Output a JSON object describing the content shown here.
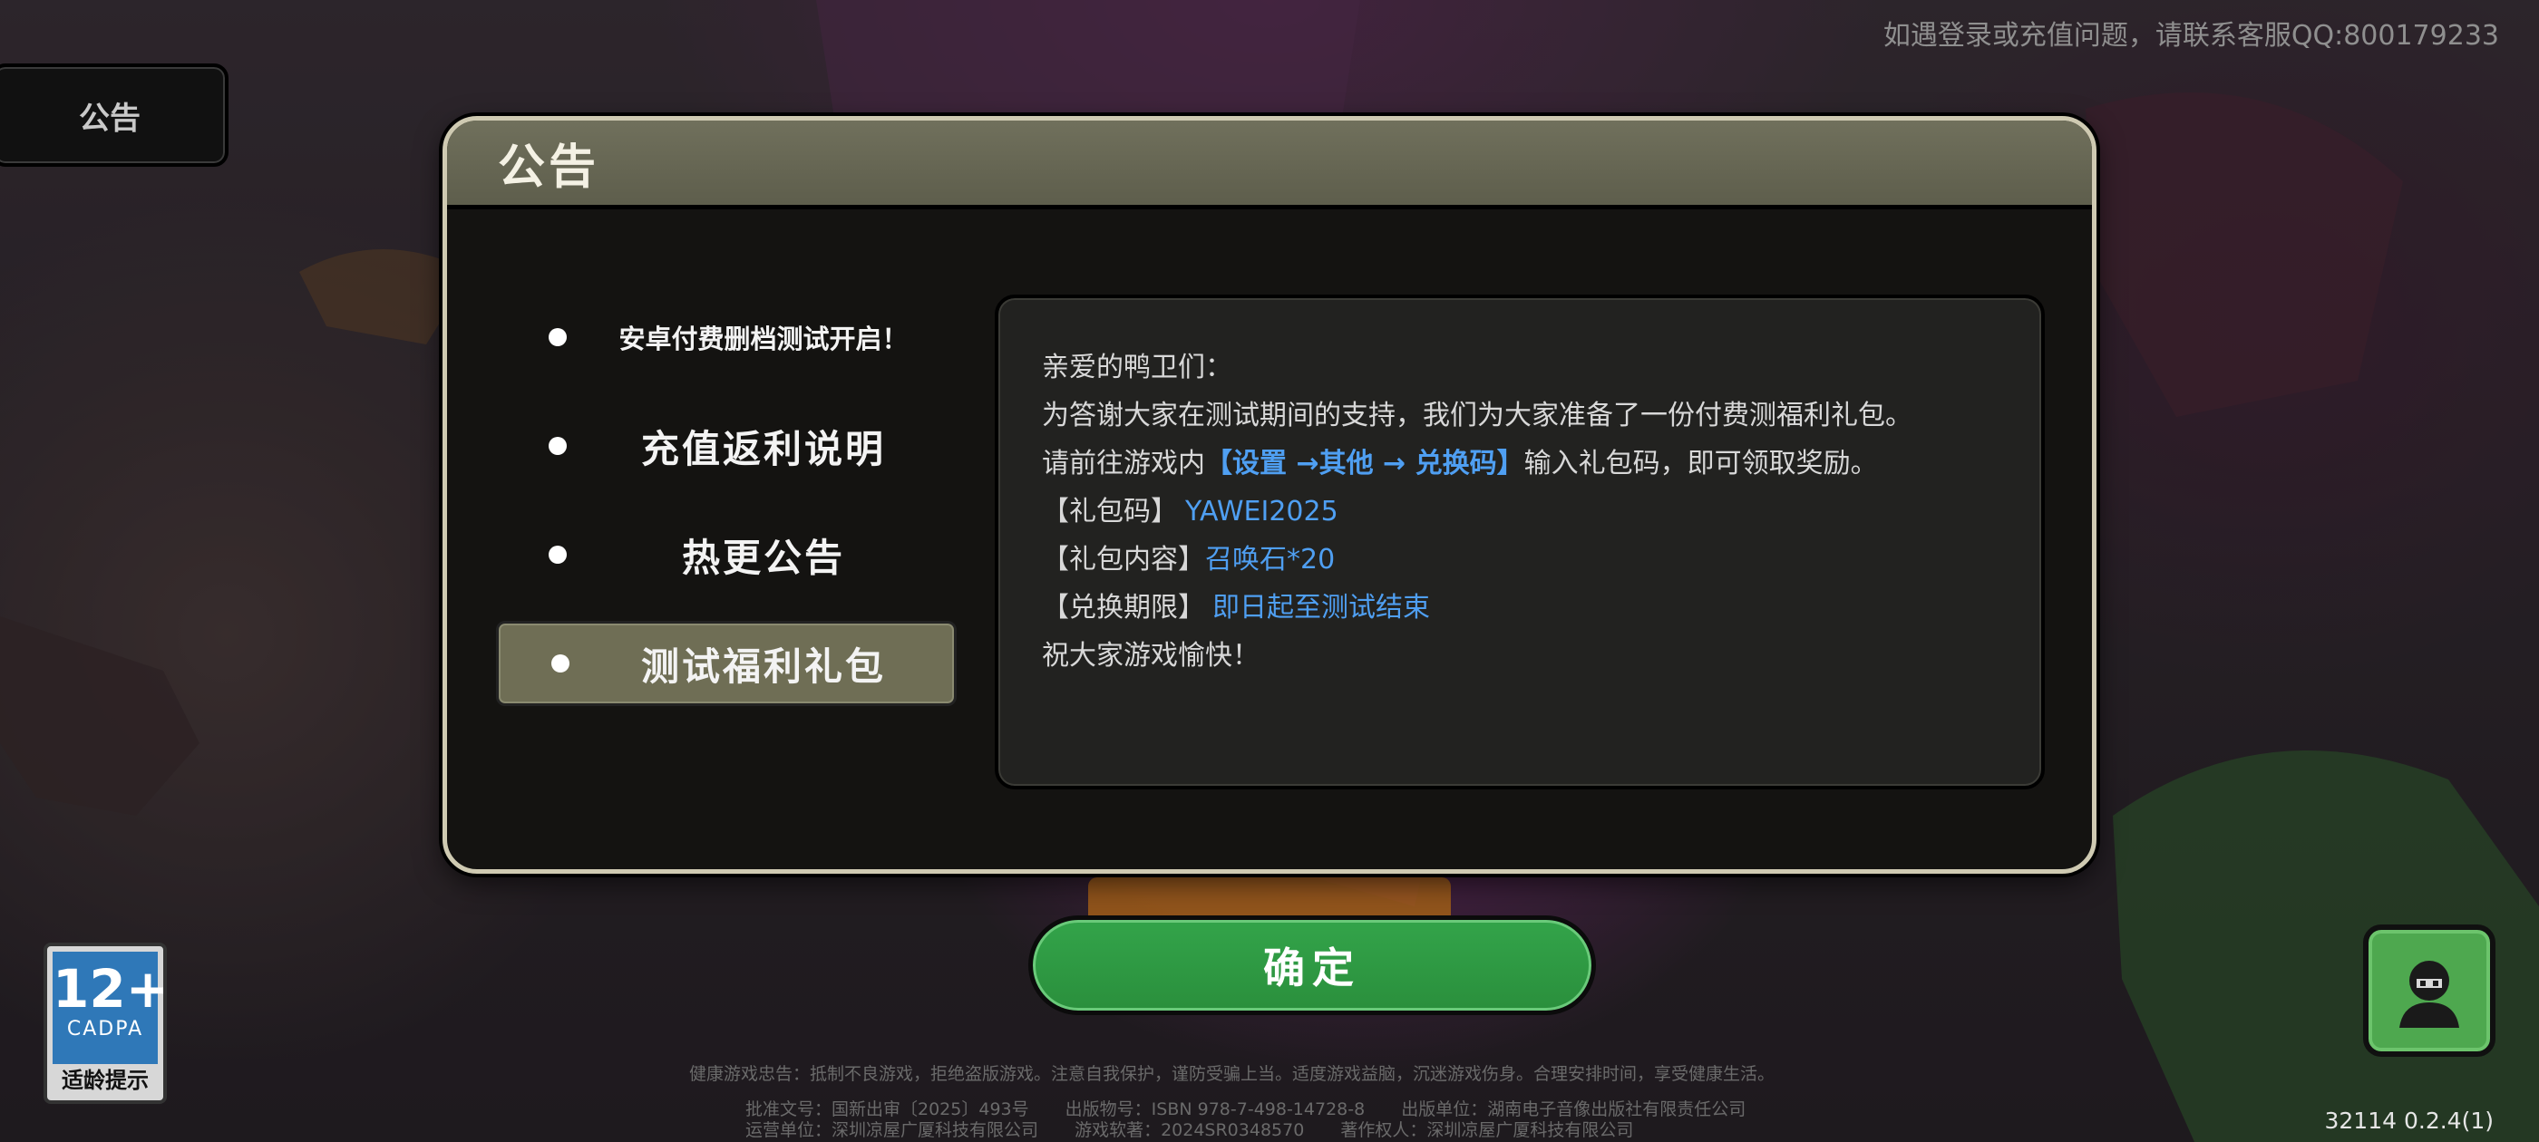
{
  "notice_tab": {
    "label": "公告"
  },
  "customer_service": "如遇登录或充值问题，请联系客服QQ:800179233",
  "modal": {
    "title": "公告",
    "tabs": [
      {
        "label": "安卓付费删档测试开启！"
      },
      {
        "label": "充值返利说明"
      },
      {
        "label": "热更公告"
      },
      {
        "label": "测试福利礼包"
      }
    ],
    "active_tab": 3,
    "content": {
      "greeting": "亲爱的鸭卫们：",
      "line1": "为答谢大家在测试期间的支持，我们为大家准备了一份付费测福利礼包。",
      "line2_prefix": "请前往游戏内",
      "line2_path": "【设置 →其他 → 兑换码】",
      "line2_suffix": "输入礼包码，即可领取奖励。",
      "code_label": "【礼包码】",
      "code_value": "YAWEI2025",
      "contents_label": "【礼包内容】",
      "contents_value": "召唤石*20",
      "period_label": "【兑换期限】",
      "period_value": "即日起至测试结束",
      "closing": "祝大家游戏愉快！"
    }
  },
  "confirm_button": "确定",
  "age_rating": {
    "number": "12+",
    "org": "CADPA",
    "tip": "适龄提示"
  },
  "footer": {
    "health_notice": "健康游戏忠告：抵制不良游戏，拒绝盗版游戏。注意自我保护，谨防受骗上当。适度游戏益脑，沉迷游戏伤身。合理安排时间，享受健康生活。",
    "approval": "批准文号：国新出审〔2025〕493号",
    "isbn": "出版物号：ISBN 978-7-498-14728-8",
    "publisher": "出版单位：湖南电子音像出版社有限责任公司",
    "operator": "运营单位：深圳凉屋广厦科技有限公司",
    "software": "游戏软著：2024SR0348570",
    "copyright": "著作权人：深圳凉屋广厦科技有限公司"
  },
  "version": "32114 0.2.4(1)",
  "colors": {
    "accent_blue": "#4f9ff2",
    "confirm_green": "#2f9c45",
    "header_olive": "#6a6a55"
  }
}
